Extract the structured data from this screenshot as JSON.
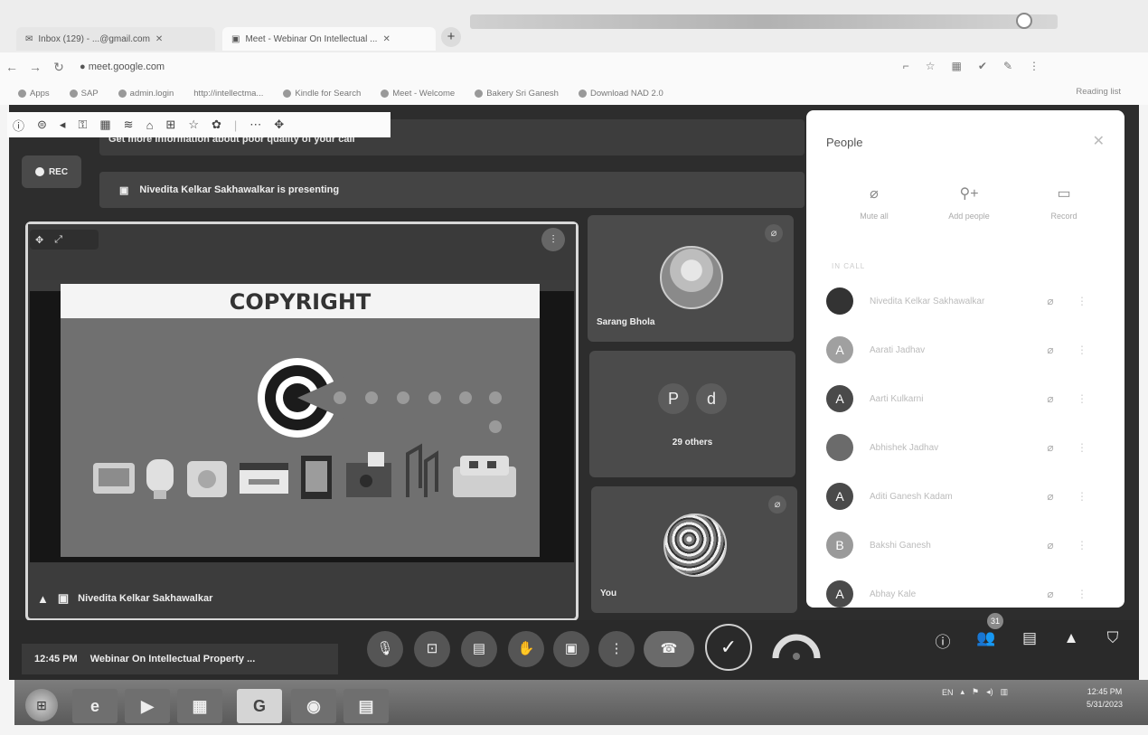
{
  "browser": {
    "tabs": [
      {
        "title": "Inbox (129) - ...@gmail.com",
        "active": false
      },
      {
        "title": "Meet - Webinar On Intellectual ...",
        "active": true
      }
    ],
    "new_tab": "+",
    "url": "meet.google.com",
    "bookmarks": [
      "Apps",
      "SAP",
      "admin.login",
      "http://intellectma...",
      "Kindle for Search",
      "Meet - Welcome",
      "Bakery Sri Ganesh",
      "Download NAD 2.0"
    ],
    "bookmarks_right": "Reading list"
  },
  "meet": {
    "notice_text": "Get more information about poor quality of your call",
    "rec_label": "REC",
    "presenting_text": "Nivedita Kelkar Sakhawalkar is presenting",
    "presenter_name": "Nivedita Kelkar Sakhawalkar",
    "slide_title": "COPYRIGHT",
    "tiles": [
      {
        "name": "Sarang Bhola"
      },
      {
        "initials": [
          "P",
          "d"
        ],
        "label": "29 others"
      },
      {
        "name": "You"
      }
    ]
  },
  "people_panel": {
    "title": "People",
    "actions": [
      "Mute all",
      "Add people",
      "Record"
    ],
    "section_label": "IN CALL",
    "participants": [
      {
        "initial": "",
        "name": "Nivedita Kelkar Sakhawalkar",
        "color": "#333333"
      },
      {
        "initial": "A",
        "name": "Aarati Jadhav",
        "color": "#a0a0a0"
      },
      {
        "initial": "A",
        "name": "Aarti Kulkarni",
        "color": "#4a4a4a"
      },
      {
        "initial": "",
        "name": "Abhishek Jadhav",
        "color": "#6b6b6b"
      },
      {
        "initial": "A",
        "name": "Aditi Ganesh Kadam",
        "color": "#4a4a4a"
      },
      {
        "initial": "B",
        "name": "Bakshi Ganesh",
        "color": "#9a9a9a"
      },
      {
        "initial": "A",
        "name": "Abhay Kale",
        "color": "#4a4a4a"
      }
    ]
  },
  "controls": {
    "time": "12:45 PM",
    "meeting_title": "Webinar On Intellectual Property ...",
    "participant_badge": "31"
  },
  "taskbar": {
    "apps": [
      "e",
      "▶",
      "▦",
      "G",
      "◉",
      "▤"
    ],
    "tray_lang": "EN",
    "clock_time": "12:45 PM",
    "clock_date": "5/31/2023"
  },
  "colors": {
    "meet_background": "#2d2d2d",
    "panel_background": "#ffffff"
  }
}
